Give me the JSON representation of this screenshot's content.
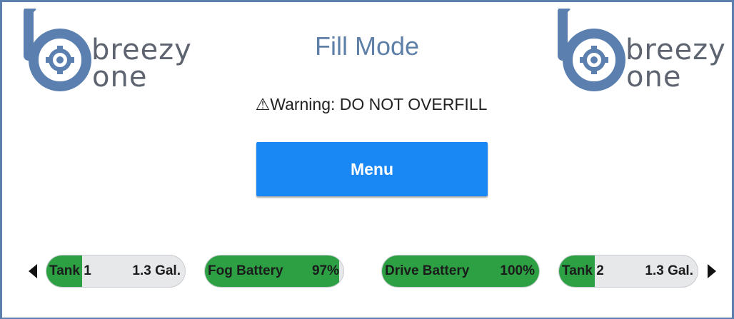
{
  "header": {
    "title": "Fill Mode",
    "warning": "⚠Warning: DO NOT OVERFILL"
  },
  "logo": {
    "line1": "breezy",
    "line2": "one",
    "color": "#5b80b0"
  },
  "menu": {
    "label": "Menu",
    "color": "#1a88f4"
  },
  "gauges": [
    {
      "label": "Tank 1",
      "value": "1.3 Gal.",
      "level_percent": 26
    },
    {
      "label": "Fog Battery",
      "value": "97%",
      "level_percent": 97
    },
    {
      "label": "Drive Battery",
      "value": "100%",
      "level_percent": 100
    },
    {
      "label": "Tank 2",
      "value": "1.3 Gal.",
      "level_percent": 26
    }
  ],
  "colors": {
    "gauge_fill": "#2ca043",
    "gauge_track": "#e7e8ea",
    "frame": "#5b80b0",
    "title": "#5e80a8"
  },
  "icons": {
    "prev": "left-arrow-icon",
    "next": "right-arrow-icon"
  }
}
